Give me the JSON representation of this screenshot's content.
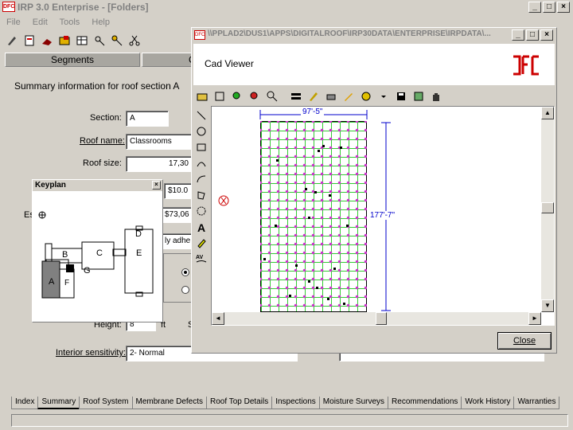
{
  "main_window": {
    "title": "IRP 3.0 Enterprise - [Folders]",
    "menu": [
      "File",
      "Edit",
      "Tools",
      "Help"
    ],
    "tabs_top": [
      "Segments",
      "C"
    ],
    "section_heading": "Summary information for roof section A",
    "fields": {
      "section_label": "Section:",
      "section_value": "A",
      "roof_name_label": "Roof name:",
      "roof_name_value": "Classrooms",
      "roof_size_label": "Roof size:",
      "roof_size_value": "17,30",
      "cost_value": "$10.0",
      "est_label": "Es",
      "est_value": "$73,06",
      "type_value": "ly adhe",
      "height_label": "Height:",
      "height_value": "8",
      "height_unit": "ft",
      "height_extra": "S",
      "interior_label": "Interior sensitivity:",
      "interior_value": "2- Normal"
    },
    "bottom_tabs": [
      "Index",
      "Summary",
      "Roof System",
      "Membrane Defects",
      "Roof Top Details",
      "Inspections",
      "Moisture Surveys",
      "Recommendations",
      "Work History",
      "Warranties"
    ],
    "active_tab": "Summary"
  },
  "keyplan": {
    "title": "Keyplan",
    "labels": [
      "D",
      "B",
      "C",
      "E",
      "G",
      "A",
      "F"
    ]
  },
  "cad_viewer": {
    "path_title": "\\\\PPLAD2\\DUS1\\APPS\\DIGITALROOF\\IRP30DATA\\ENTERPRISE\\IRPDATA\\...",
    "header": "Cad Viewer",
    "dim_top": "97'-5\"",
    "dim_side": "177'-7\"",
    "close_label": "Close",
    "brand_color": "#cc0000"
  }
}
